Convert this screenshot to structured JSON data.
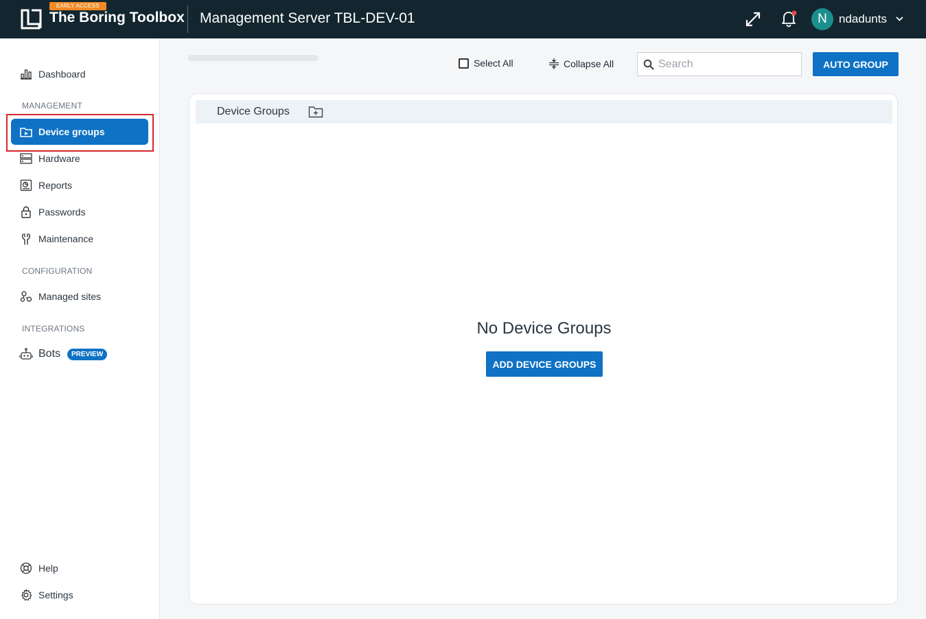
{
  "header": {
    "badge": "EARLY ACCESS",
    "app_title": "The Boring Toolbox",
    "server_title": "Management Server TBL-DEV-01",
    "user_initial": "N",
    "username": "ndadunts"
  },
  "sidebar": {
    "dashboard": "Dashboard",
    "section_management": "MANAGEMENT",
    "device_groups": "Device groups",
    "hardware": "Hardware",
    "reports": "Reports",
    "passwords": "Passwords",
    "maintenance": "Maintenance",
    "section_configuration": "CONFIGURATION",
    "managed_sites": "Managed sites",
    "section_integrations": "INTEGRATIONS",
    "bots": "Bots",
    "bots_badge": "PREVIEW",
    "help": "Help",
    "settings": "Settings"
  },
  "toolbar": {
    "select_all": "Select All",
    "collapse_all": "Collapse All",
    "search_placeholder": "Search",
    "auto_group": "AUTO GROUP"
  },
  "panel": {
    "header_title": "Device Groups",
    "empty_title": "No Device Groups",
    "add_button": "ADD DEVICE GROUPS"
  },
  "colors": {
    "topbar": "#13262f",
    "accent": "#0f72c4",
    "badge": "#f08a24",
    "avatar": "#1b8f8c",
    "highlight": "#d6262c"
  }
}
